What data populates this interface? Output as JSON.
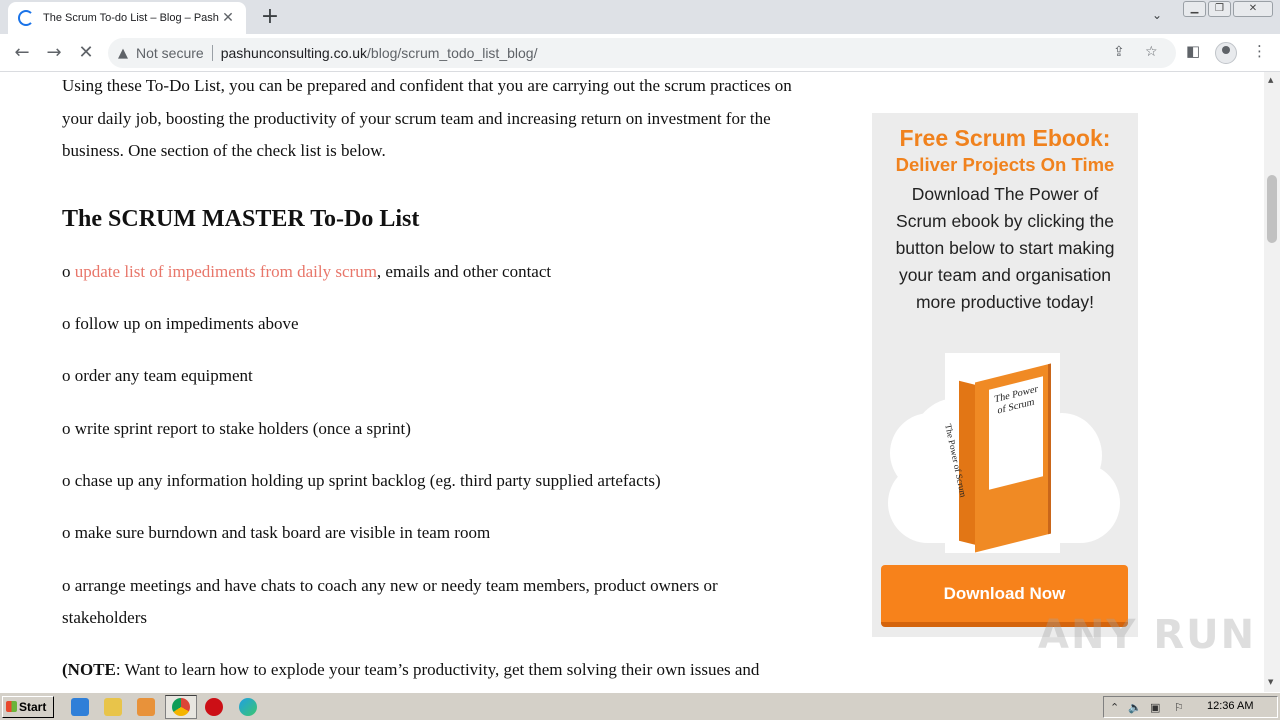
{
  "browser": {
    "tab_title": "The Scrum To-do List – Blog – Pashun",
    "new_tab_icon": "+",
    "address": {
      "security_label": "Not secure",
      "domain": "pashunconsulting.co.uk",
      "path": "/blog/scrum_todo_list_blog/"
    }
  },
  "article": {
    "intro": "Using these To-Do List, you can be prepared and confident that you are carrying out the scrum practices on your daily job, boosting the productivity of your scrum team and increasing return on investment for the business. One section of the check list is below.",
    "heading": "The SCRUM MASTER To-Do List",
    "items": [
      {
        "bullet": "o",
        "link": "update list of impediments from daily scrum",
        "text": ", emails and other contact"
      },
      {
        "bullet": "o",
        "text": "follow up on impediments above"
      },
      {
        "bullet": "o",
        "text": "order any team equipment"
      },
      {
        "bullet": "o",
        "text": "write sprint report to stake holders (once a sprint)"
      },
      {
        "bullet": "o",
        "text": "chase up any information holding up sprint backlog (eg. third party supplied artefacts)"
      },
      {
        "bullet": "o",
        "text": "make sure burndown and task board are visible in team room"
      },
      {
        "bullet": "o",
        "text": "arrange meetings and have chats to coach any new or needy team members, product owners or stakeholders"
      }
    ],
    "note_bold": "(NOTE",
    "note_text": ": Want to learn how to explode your team’s productivity, get them solving their own issues and"
  },
  "ad": {
    "title1": "Free Scrum Ebook:",
    "title2": "Deliver Projects On Time",
    "body": "Download The Power of Scrum ebook by clicking the button below to start making your team and organisation more productive  today!",
    "book_title": "The Power of Scrum",
    "book_spine": "The Power of Scrum",
    "button": "Download Now"
  },
  "watermark": "ANY RUN",
  "taskbar": {
    "start_label": "Start",
    "clock": "12:36 AM"
  },
  "colors": {
    "accent_orange": "#f0821e",
    "link_color": "#e8766a"
  }
}
